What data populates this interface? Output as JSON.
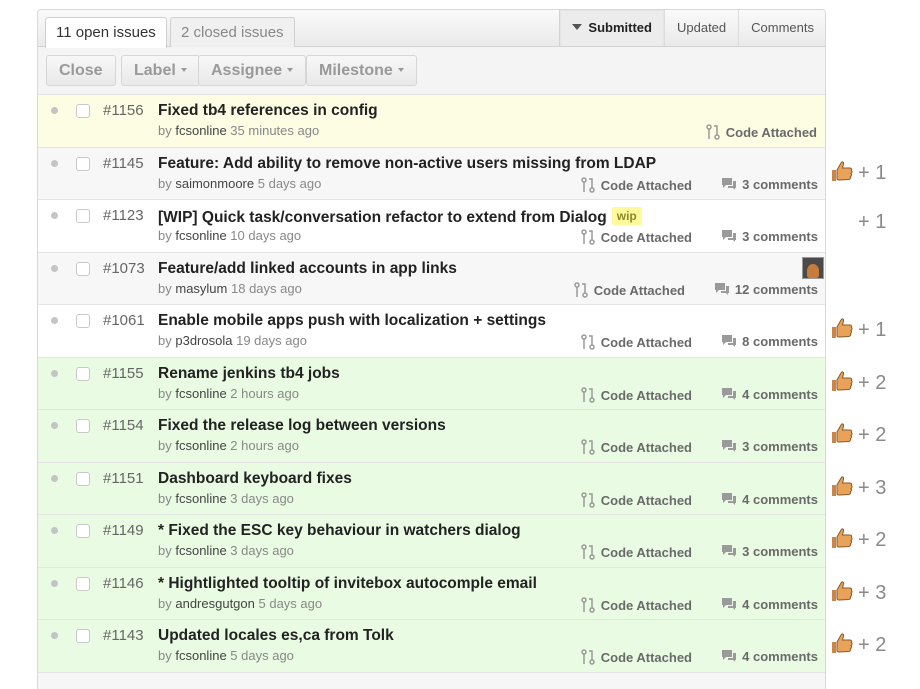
{
  "tabs": [
    {
      "label": "11 open issues",
      "active": true
    },
    {
      "label": "2 closed issues",
      "active": false
    }
  ],
  "sort": [
    {
      "label": "Submitted",
      "active": true
    },
    {
      "label": "Updated",
      "active": false
    },
    {
      "label": "Comments",
      "active": false
    }
  ],
  "actions": {
    "close": "Close",
    "label": "Label",
    "assignee": "Assignee",
    "milestone": "Milestone"
  },
  "code_label": "Code Attached",
  "issues": [
    {
      "number": "#1156",
      "title": "Fixed tb4 references in config",
      "by": "by",
      "author": "fcsonline",
      "time": "35 minutes ago",
      "comments": "",
      "votes": "",
      "row": "yellow"
    },
    {
      "number": "#1145",
      "title": "Feature: Add ability to remove non-active users missing from LDAP",
      "by": "by",
      "author": "saimonmoore",
      "time": "5 days ago",
      "comments": "3 comments",
      "votes": "+ 1",
      "row": "gray"
    },
    {
      "number": "#1123",
      "title": "[WIP] Quick task/conversation refactor to extend from Dialog",
      "tag": "wip",
      "by": "by",
      "author": "fcsonline",
      "time": "10 days ago",
      "comments": "3 comments",
      "votes": "+ 1",
      "row": "white"
    },
    {
      "number": "#1073",
      "title": "Feature/add linked accounts in app links",
      "by": "by",
      "author": "masylum",
      "time": "18 days ago",
      "comments": "12 comments",
      "votes": "",
      "row": "gray"
    },
    {
      "number": "#1061",
      "title": "Enable mobile apps push with localization + settings",
      "by": "by",
      "author": "p3drosola",
      "time": "19 days ago",
      "comments": "8 comments",
      "votes": "+ 1",
      "row": "white"
    },
    {
      "number": "#1155",
      "title": "Rename jenkins tb4 jobs",
      "by": "by",
      "author": "fcsonline",
      "time": "2 hours ago",
      "comments": "4 comments",
      "votes": "+ 2",
      "row": "green"
    },
    {
      "number": "#1154",
      "title": "Fixed the release log between versions",
      "by": "by",
      "author": "fcsonline",
      "time": "2 hours ago",
      "comments": "3 comments",
      "votes": "+ 2",
      "row": "green"
    },
    {
      "number": "#1151",
      "title": "Dashboard keyboard fixes",
      "by": "by",
      "author": "fcsonline",
      "time": "3 days ago",
      "comments": "4 comments",
      "votes": "+ 3",
      "row": "green"
    },
    {
      "number": "#1149",
      "title": "* Fixed the ESC key behaviour in watchers dialog",
      "by": "by",
      "author": "fcsonline",
      "time": "3 days ago",
      "comments": "3 comments",
      "votes": "+ 2",
      "row": "green"
    },
    {
      "number": "#1146",
      "title": "* Hightlighted tooltip of invitebox autocomple email",
      "by": "by",
      "author": "andresgutgon",
      "time": "5 days ago",
      "comments": "4 comments",
      "votes": "+ 3",
      "row": "green"
    },
    {
      "number": "#1143",
      "title": "Updated locales es,ca from Tolk",
      "by": "by",
      "author": "fcsonline",
      "time": "5 days ago",
      "comments": "4 comments",
      "votes": "+ 2",
      "row": "green"
    }
  ]
}
